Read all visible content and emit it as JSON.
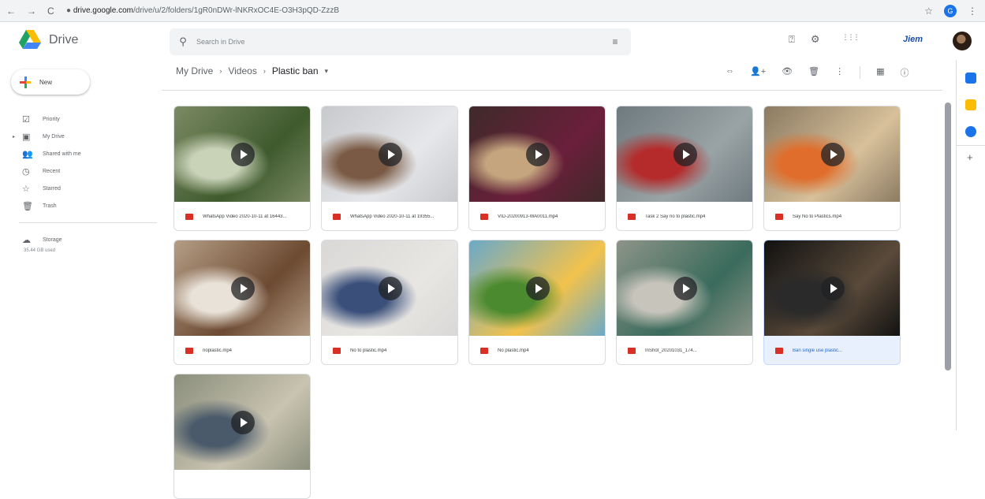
{
  "browser": {
    "nav_icons": [
      "←",
      "→",
      "C"
    ],
    "url_domain": "drive.google.com",
    "url_path": "/drive/u/2/folders/1gR0nDWr-lNKRxOC4E-O3H3pQD-ZzzB",
    "star_icon": "☆",
    "profile_initial": "G",
    "menu_icon": "⋮"
  },
  "header": {
    "app_name": "Drive",
    "search_placeholder": "Search in Drive",
    "search_icon": "search-icon",
    "help_icon": "⍰",
    "settings_icon": "⚙",
    "apps_icon": "⋮⋮⋮",
    "brand_text": "Jiem"
  },
  "sidebar": {
    "new_label": "New",
    "items": [
      {
        "label": "Priority",
        "icon": "☑"
      },
      {
        "label": "My Drive",
        "icon": "▣"
      },
      {
        "label": "Shared with me",
        "icon": "👥"
      },
      {
        "label": "Recent",
        "icon": "◷"
      },
      {
        "label": "Starred",
        "icon": "☆"
      },
      {
        "label": "Trash",
        "icon": "🗑"
      }
    ],
    "storage_label": "Storage",
    "storage_icon": "☁",
    "storage_used": "35.44 GB used"
  },
  "main": {
    "breadcrumb": [
      "My Drive",
      "Videos",
      "Plastic ban"
    ],
    "breadcrumb_sep": "›",
    "breadcrumb_dropdown": "▾",
    "toolbar_icons": [
      "⇔",
      "👤+",
      "👁",
      "🗑",
      "⋮",
      "▦",
      "ⓘ"
    ],
    "files": [
      {
        "name": "WhatsApp Video 2020-10-11 at 16443...",
        "colors": [
          "#7b8a63",
          "#3f5a2d",
          "#c9d3b8"
        ]
      },
      {
        "name": "WhatsApp Video 2020-10-11 at 19355...",
        "colors": [
          "#c8c9cc",
          "#e6e7ea",
          "#7a5a44"
        ]
      },
      {
        "name": "VID-20200913-WA0011.mp4",
        "colors": [
          "#3e2a2a",
          "#6b1f3b",
          "#c4a57e"
        ]
      },
      {
        "name": "Task 2 Say no to plastic.mp4",
        "colors": [
          "#6e7a7e",
          "#9aa3a5",
          "#b52b2b"
        ]
      },
      {
        "name": "Say No to Plastics.mp4",
        "colors": [
          "#8b7a62",
          "#d7c09a",
          "#e06d2b"
        ]
      },
      {
        "name": "noplastic.mp4",
        "colors": [
          "#b49d85",
          "#6d4a32",
          "#e9e2d8"
        ]
      },
      {
        "name": "No to plastic.mp4",
        "colors": [
          "#d9d8d6",
          "#e8e6e3",
          "#3a4f7a"
        ]
      },
      {
        "name": "No plastic.mp4",
        "colors": [
          "#6aa9c9",
          "#f2c24c",
          "#4b8a2e"
        ]
      },
      {
        "name": "InShot_20201031_174...",
        "colors": [
          "#8d9488",
          "#3a6b5c",
          "#c7c4bb"
        ]
      },
      {
        "name": "Ban single use plastic...",
        "colors": [
          "#111111",
          "#5a4a3a",
          "#2a2a2a"
        ],
        "selected": true
      },
      {
        "name": "",
        "colors": [
          "#8a8f7c",
          "#c9c3b1",
          "#4a5a6a"
        ]
      }
    ]
  },
  "side_panel": {
    "icons": [
      {
        "name": "calendar",
        "color": "#1a73e8"
      },
      {
        "name": "keep",
        "color": "#fbbc04"
      },
      {
        "name": "tasks",
        "color": "#1a73e8"
      }
    ],
    "add_label": "+"
  }
}
